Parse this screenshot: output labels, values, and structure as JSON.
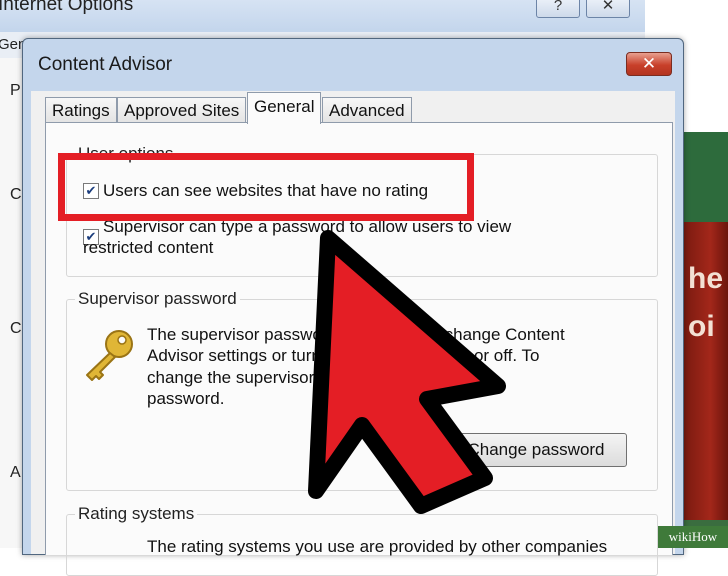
{
  "background_window": {
    "title": "Internet Options",
    "help_button": "?",
    "close_button": "✕",
    "first_tab": "Gen",
    "side_letters": [
      "P",
      "C",
      "C",
      "A"
    ]
  },
  "background_page": {
    "text_lines": [
      "he",
      "oi"
    ],
    "watermark": "wikiHow"
  },
  "dialog": {
    "title": "Content Advisor",
    "close_button": "✕",
    "tabs": [
      "Ratings",
      "Approved Sites",
      "General",
      "Advanced"
    ],
    "active_tab": "General",
    "user_options": {
      "title": "User options",
      "options": [
        {
          "label": "Users can see websites that have no rating",
          "checked": true
        },
        {
          "label_lines": [
            "Supervisor can type a password to allow users to view",
            "restricted content"
          ],
          "checked": true
        }
      ]
    },
    "supervisor_password": {
      "title": "Supervisor password",
      "text_lines": [
        "The supervisor password allows you to change Content",
        "Advisor settings or turn Content Advisor on or off. To",
        "change the supervisor password, click Change",
        "password."
      ],
      "button": "Change password",
      "icon": "key-icon"
    },
    "rating_systems": {
      "title": "Rating systems",
      "text": "The rating systems you use are provided by other companies"
    }
  },
  "annotations": {
    "highlight_color": "#e41e25",
    "arrow_color": "#e41e25"
  }
}
